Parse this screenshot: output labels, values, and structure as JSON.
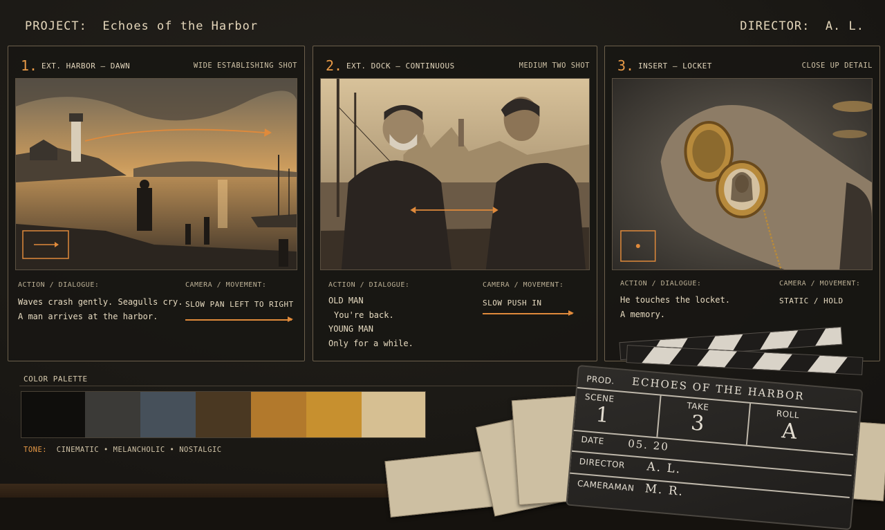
{
  "header": {
    "project_key": "PROJECT:",
    "project_value": "Echoes of the Harbor",
    "director_key": "DIRECTOR:",
    "director_value": "A. L."
  },
  "panels": [
    {
      "number": "1.",
      "scene": "EXT. HARBOR – DAWN",
      "shot": "WIDE ESTABLISHING SHOT",
      "action_label": "ACTION / DIALOGUE:",
      "action_lines": [
        "Waves crash gently. Seagulls cry.",
        "A man arrives at the harbor."
      ],
      "camera_label": "CAMERA / MOVEMENT:",
      "camera": "SLOW PAN LEFT TO RIGHT"
    },
    {
      "number": "2.",
      "scene": "EXT. DOCK – CONTINUOUS",
      "shot": "MEDIUM TWO SHOT",
      "action_label": "ACTION / DIALOGUE:",
      "action_lines": [
        "OLD MAN",
        "You're back.",
        "YOUNG MAN",
        "Only for a while."
      ],
      "camera_label": "CAMERA / MOVEMENT:",
      "camera": "SLOW PUSH IN"
    },
    {
      "number": "3.",
      "scene": "INSERT – LOCKET",
      "shot": "CLOSE UP DETAIL",
      "action_label": "ACTION / DIALOGUE:",
      "action_lines": [
        "He touches the locket.",
        "A memory."
      ],
      "camera_label": "CAMERA / MOVEMENT:",
      "camera": "STATIC / HOLD"
    }
  ],
  "palette": {
    "title": "COLOR PALETTE",
    "colors": [
      "#0f0e0c",
      "#3b3a37",
      "#46505a",
      "#4a3822",
      "#b2792c",
      "#c7902f",
      "#d6bf92"
    ],
    "tone_key": "TONE:",
    "tone_items": [
      "CINEMATIC",
      "MELANCHOLIC",
      "NOSTALGIC"
    ],
    "tone_sep": "•"
  },
  "clapper": {
    "prod_key": "PROD.",
    "prod_value": "ECHOES OF THE HARBOR",
    "scene_key": "SCENE",
    "scene_value": "1",
    "take_key": "TAKE",
    "take_value": "3",
    "roll_key": "ROLL",
    "roll_value": "A",
    "date_key": "DATE",
    "date_value": "05. 20",
    "director_key": "DIRECTOR",
    "director_value": "A. L.",
    "cameraman_key": "CAMERAMAN",
    "cameraman_value": "M. R."
  },
  "colors": {
    "accent": "#e89a47",
    "board": "#1b1915",
    "border": "#6d604c"
  }
}
